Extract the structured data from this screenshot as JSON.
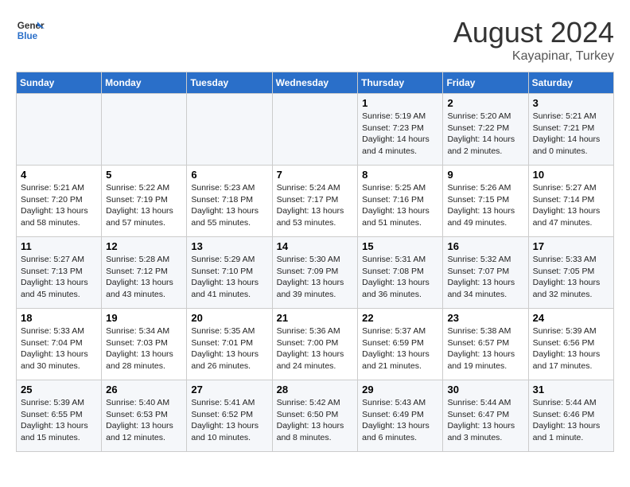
{
  "header": {
    "logo_line1": "General",
    "logo_line2": "Blue",
    "month": "August 2024",
    "location": "Kayapinar, Turkey"
  },
  "days_of_week": [
    "Sunday",
    "Monday",
    "Tuesday",
    "Wednesday",
    "Thursday",
    "Friday",
    "Saturday"
  ],
  "weeks": [
    [
      {
        "day": "",
        "info": ""
      },
      {
        "day": "",
        "info": ""
      },
      {
        "day": "",
        "info": ""
      },
      {
        "day": "",
        "info": ""
      },
      {
        "day": "1",
        "info": "Sunrise: 5:19 AM\nSunset: 7:23 PM\nDaylight: 14 hours\nand 4 minutes."
      },
      {
        "day": "2",
        "info": "Sunrise: 5:20 AM\nSunset: 7:22 PM\nDaylight: 14 hours\nand 2 minutes."
      },
      {
        "day": "3",
        "info": "Sunrise: 5:21 AM\nSunset: 7:21 PM\nDaylight: 14 hours\nand 0 minutes."
      }
    ],
    [
      {
        "day": "4",
        "info": "Sunrise: 5:21 AM\nSunset: 7:20 PM\nDaylight: 13 hours\nand 58 minutes."
      },
      {
        "day": "5",
        "info": "Sunrise: 5:22 AM\nSunset: 7:19 PM\nDaylight: 13 hours\nand 57 minutes."
      },
      {
        "day": "6",
        "info": "Sunrise: 5:23 AM\nSunset: 7:18 PM\nDaylight: 13 hours\nand 55 minutes."
      },
      {
        "day": "7",
        "info": "Sunrise: 5:24 AM\nSunset: 7:17 PM\nDaylight: 13 hours\nand 53 minutes."
      },
      {
        "day": "8",
        "info": "Sunrise: 5:25 AM\nSunset: 7:16 PM\nDaylight: 13 hours\nand 51 minutes."
      },
      {
        "day": "9",
        "info": "Sunrise: 5:26 AM\nSunset: 7:15 PM\nDaylight: 13 hours\nand 49 minutes."
      },
      {
        "day": "10",
        "info": "Sunrise: 5:27 AM\nSunset: 7:14 PM\nDaylight: 13 hours\nand 47 minutes."
      }
    ],
    [
      {
        "day": "11",
        "info": "Sunrise: 5:27 AM\nSunset: 7:13 PM\nDaylight: 13 hours\nand 45 minutes."
      },
      {
        "day": "12",
        "info": "Sunrise: 5:28 AM\nSunset: 7:12 PM\nDaylight: 13 hours\nand 43 minutes."
      },
      {
        "day": "13",
        "info": "Sunrise: 5:29 AM\nSunset: 7:10 PM\nDaylight: 13 hours\nand 41 minutes."
      },
      {
        "day": "14",
        "info": "Sunrise: 5:30 AM\nSunset: 7:09 PM\nDaylight: 13 hours\nand 39 minutes."
      },
      {
        "day": "15",
        "info": "Sunrise: 5:31 AM\nSunset: 7:08 PM\nDaylight: 13 hours\nand 36 minutes."
      },
      {
        "day": "16",
        "info": "Sunrise: 5:32 AM\nSunset: 7:07 PM\nDaylight: 13 hours\nand 34 minutes."
      },
      {
        "day": "17",
        "info": "Sunrise: 5:33 AM\nSunset: 7:05 PM\nDaylight: 13 hours\nand 32 minutes."
      }
    ],
    [
      {
        "day": "18",
        "info": "Sunrise: 5:33 AM\nSunset: 7:04 PM\nDaylight: 13 hours\nand 30 minutes."
      },
      {
        "day": "19",
        "info": "Sunrise: 5:34 AM\nSunset: 7:03 PM\nDaylight: 13 hours\nand 28 minutes."
      },
      {
        "day": "20",
        "info": "Sunrise: 5:35 AM\nSunset: 7:01 PM\nDaylight: 13 hours\nand 26 minutes."
      },
      {
        "day": "21",
        "info": "Sunrise: 5:36 AM\nSunset: 7:00 PM\nDaylight: 13 hours\nand 24 minutes."
      },
      {
        "day": "22",
        "info": "Sunrise: 5:37 AM\nSunset: 6:59 PM\nDaylight: 13 hours\nand 21 minutes."
      },
      {
        "day": "23",
        "info": "Sunrise: 5:38 AM\nSunset: 6:57 PM\nDaylight: 13 hours\nand 19 minutes."
      },
      {
        "day": "24",
        "info": "Sunrise: 5:39 AM\nSunset: 6:56 PM\nDaylight: 13 hours\nand 17 minutes."
      }
    ],
    [
      {
        "day": "25",
        "info": "Sunrise: 5:39 AM\nSunset: 6:55 PM\nDaylight: 13 hours\nand 15 minutes."
      },
      {
        "day": "26",
        "info": "Sunrise: 5:40 AM\nSunset: 6:53 PM\nDaylight: 13 hours\nand 12 minutes."
      },
      {
        "day": "27",
        "info": "Sunrise: 5:41 AM\nSunset: 6:52 PM\nDaylight: 13 hours\nand 10 minutes."
      },
      {
        "day": "28",
        "info": "Sunrise: 5:42 AM\nSunset: 6:50 PM\nDaylight: 13 hours\nand 8 minutes."
      },
      {
        "day": "29",
        "info": "Sunrise: 5:43 AM\nSunset: 6:49 PM\nDaylight: 13 hours\nand 6 minutes."
      },
      {
        "day": "30",
        "info": "Sunrise: 5:44 AM\nSunset: 6:47 PM\nDaylight: 13 hours\nand 3 minutes."
      },
      {
        "day": "31",
        "info": "Sunrise: 5:44 AM\nSunset: 6:46 PM\nDaylight: 13 hours\nand 1 minute."
      }
    ]
  ]
}
